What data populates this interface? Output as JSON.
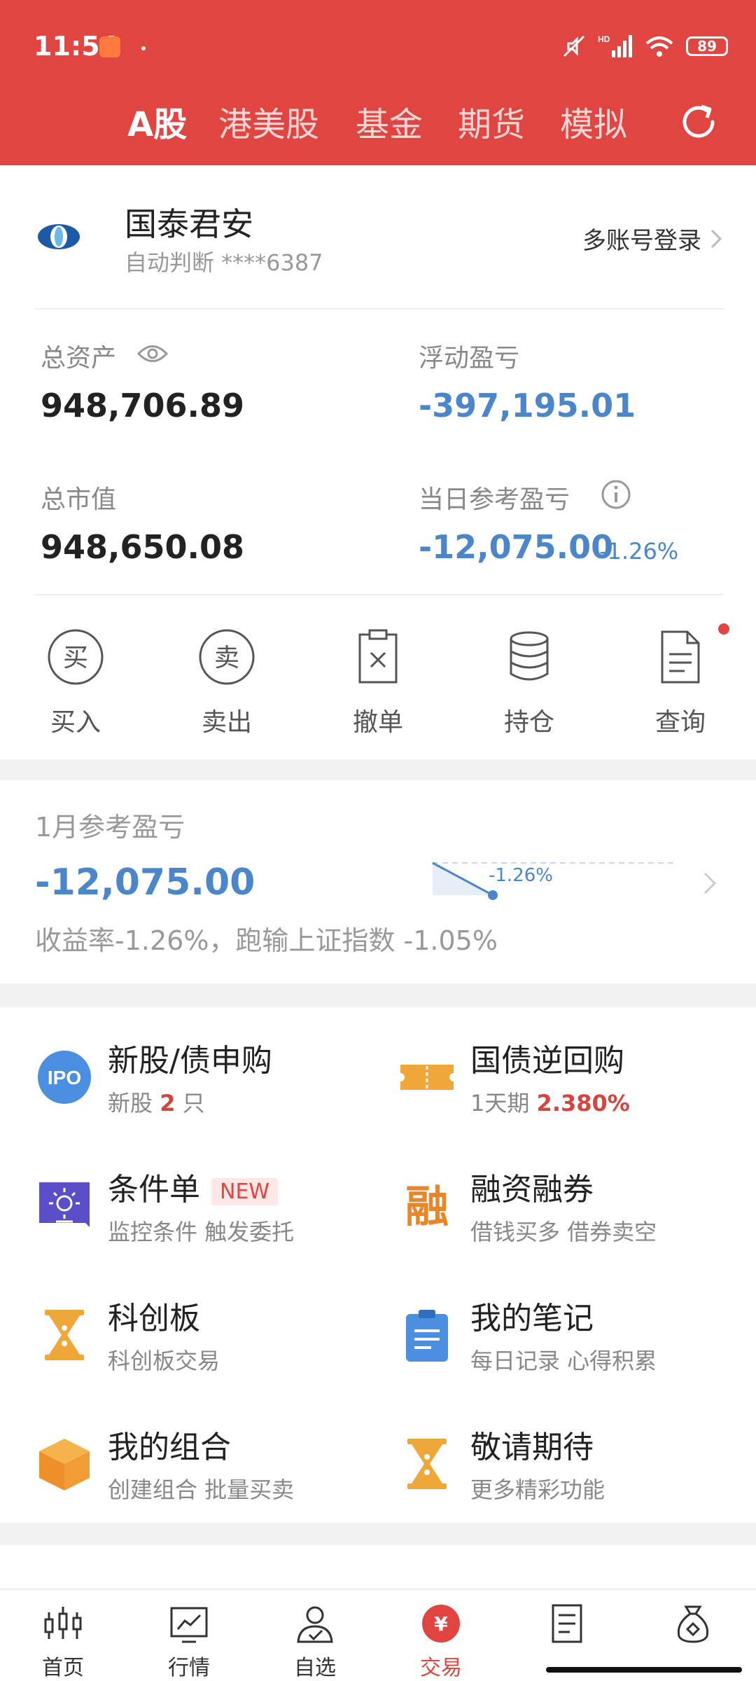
{
  "status_bar": {
    "time": "11:54",
    "battery": "89",
    "hd_label": "HD"
  },
  "top_tabs": [
    {
      "label": "A股",
      "active": true
    },
    {
      "label": "港美股"
    },
    {
      "label": "基金"
    },
    {
      "label": "期货"
    },
    {
      "label": "模拟"
    }
  ],
  "account": {
    "broker_name": "国泰君安",
    "account_sub": "自动判断 ****6387",
    "multi_login": "多账号登录",
    "total_assets_label": "总资产",
    "total_assets": "948,706.89",
    "floating_pl_label": "浮动盈亏",
    "floating_pl": "-397,195.01",
    "market_value_label": "总市值",
    "market_value": "948,650.08",
    "daily_pl_label": "当日参考盈亏",
    "daily_pl": "-12,075.00",
    "daily_pl_pct": "-1.26%"
  },
  "actions": [
    {
      "label": "买入",
      "icon": "buy-icon",
      "glyph": "买"
    },
    {
      "label": "卖出",
      "icon": "sell-icon",
      "glyph": "卖"
    },
    {
      "label": "撤单",
      "icon": "cancel-order-icon"
    },
    {
      "label": "持仓",
      "icon": "holdings-icon"
    },
    {
      "label": "查询",
      "icon": "query-icon"
    }
  ],
  "monthly": {
    "title": "1月参考盈亏",
    "value": "-12,075.00",
    "chart_pct": "-1.26%",
    "desc": "收益率-1.26%，跑输上证指数 -1.05%"
  },
  "features": [
    {
      "title": "新股/债申购",
      "sub_prefix": "新股 ",
      "sub_highlight": "2",
      "sub_suffix": " 只",
      "icon": "ipo-icon",
      "icon_text": "IPO"
    },
    {
      "title": "国债逆回购",
      "sub_prefix": "1天期 ",
      "sub_highlight": "2.380%",
      "sub_suffix": "",
      "icon": "ticket-icon"
    },
    {
      "title": "条件单",
      "badge": "NEW",
      "sub_prefix": "监控条件 触发委托",
      "icon": "condition-order-icon"
    },
    {
      "title": "融资融券",
      "sub_prefix": "借钱买多 借券卖空",
      "icon": "margin-icon",
      "icon_text": "融"
    },
    {
      "title": "科创板",
      "sub_prefix": "科创板交易",
      "icon": "hourglass-icon"
    },
    {
      "title": "我的笔记",
      "sub_prefix": "每日记录 心得积累",
      "icon": "notes-icon"
    },
    {
      "title": "我的组合",
      "sub_prefix": "创建组合 批量买卖",
      "icon": "box-icon"
    },
    {
      "title": "敬请期待",
      "sub_prefix": "更多精彩功能",
      "icon": "hourglass-icon"
    }
  ],
  "bottom_nav": [
    {
      "label": "首页",
      "icon": "candlestick-icon"
    },
    {
      "label": "行情",
      "icon": "chart-icon"
    },
    {
      "label": "自选",
      "icon": "user-check-icon"
    },
    {
      "label": "交易",
      "icon": "yuan-icon",
      "active": true,
      "glyph": "¥"
    },
    {
      "label": "",
      "icon": "document-icon"
    },
    {
      "label": "",
      "icon": "money-bag-icon"
    }
  ],
  "colors": {
    "brand_red": "#e04541",
    "loss_blue": "#4a86c9"
  }
}
